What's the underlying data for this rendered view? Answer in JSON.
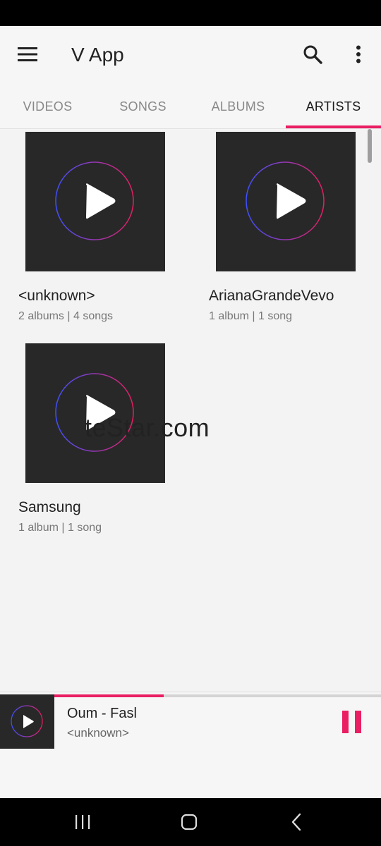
{
  "app": {
    "title": "V App"
  },
  "icons": {
    "menu": "menu-icon",
    "search": "search-icon",
    "more": "more-vert-icon",
    "play": "play-icon",
    "pause": "pause-icon",
    "recents": "recents-icon",
    "home": "home-icon",
    "back": "back-icon"
  },
  "colors": {
    "accent": "#e91e63",
    "ring_start": "#3f51ff",
    "thumb_bg": "#282828"
  },
  "tabs": [
    {
      "label": "VIDEOS",
      "active": false
    },
    {
      "label": "SONGS",
      "active": false
    },
    {
      "label": "ALBUMS",
      "active": false
    },
    {
      "label": "ARTISTS",
      "active": true
    }
  ],
  "artists": [
    {
      "name": "<unknown>",
      "meta": "2 albums | 4 songs"
    },
    {
      "name": "ArianaGrandeVevo",
      "meta": "1 album | 1 song"
    },
    {
      "name": "Samsung",
      "meta": "1 album | 1 song"
    }
  ],
  "watermark": "teStar.com",
  "now_playing": {
    "title": "Oum - Fasl",
    "artist": "<unknown>",
    "progress": 0.43
  }
}
